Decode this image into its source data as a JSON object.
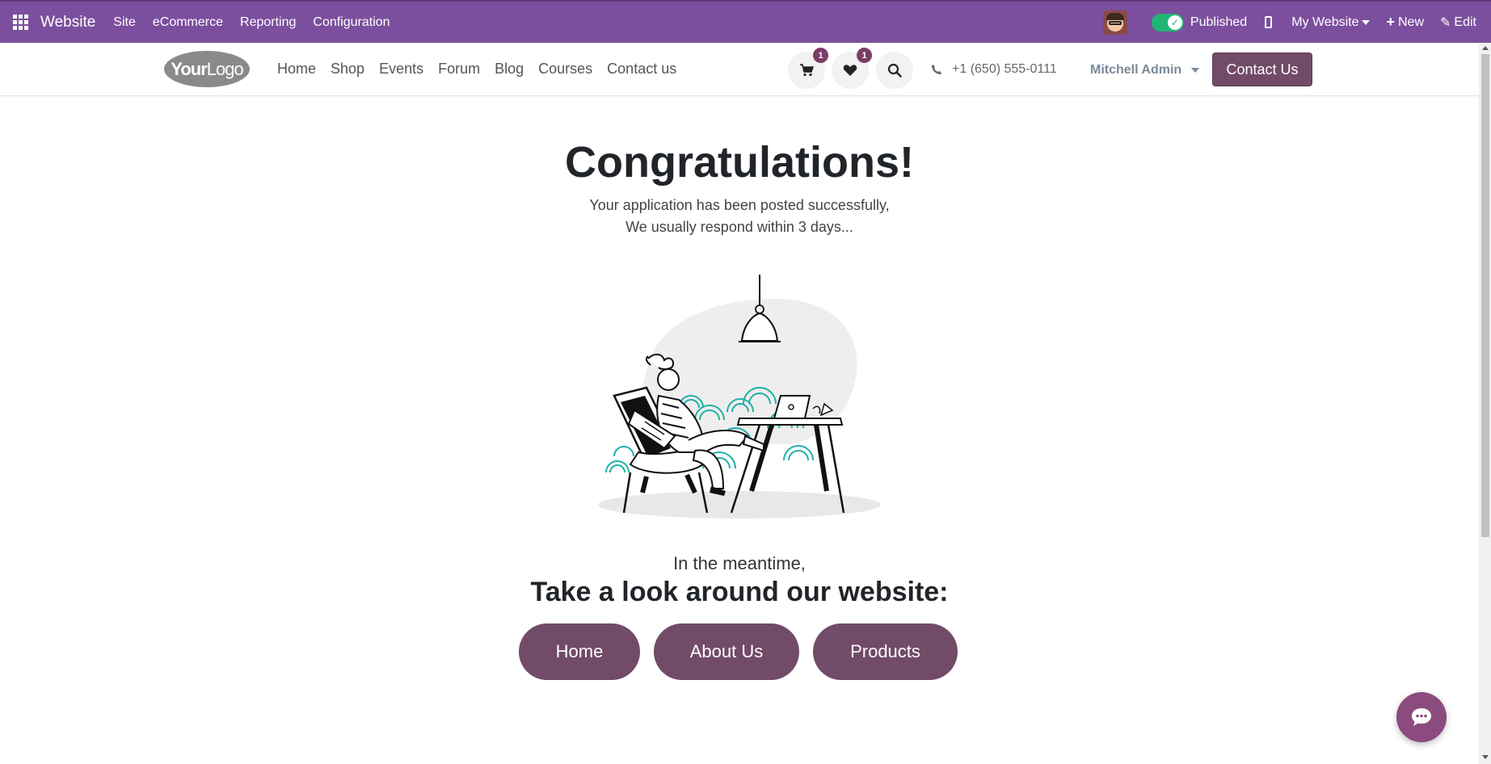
{
  "adminbar": {
    "brand": "Website",
    "menus": [
      "Site",
      "eCommerce",
      "Reporting",
      "Configuration"
    ],
    "published_label": "Published",
    "my_website_label": "My Website",
    "new_label": "New",
    "edit_label": "Edit",
    "accent": "#7c4f9e"
  },
  "header": {
    "logo_text_1": "Your",
    "logo_text_2": "Logo",
    "nav": [
      "Home",
      "Shop",
      "Events",
      "Forum",
      "Blog",
      "Courses",
      "Contact us"
    ],
    "cart_count": "1",
    "wishlist_count": "1",
    "phone": "+1 (650) 555-0111",
    "user": "Mitchell Admin",
    "contact_button": "Contact Us",
    "brand_color": "#714b67"
  },
  "main": {
    "title": "Congratulations!",
    "line1": "Your application has been posted successfully,",
    "line2": "We usually respond within 3 days...",
    "meantime": "In the meantime,",
    "lookaround": "Take a look around our website:",
    "buttons": [
      "Home",
      "About Us",
      "Products"
    ]
  }
}
